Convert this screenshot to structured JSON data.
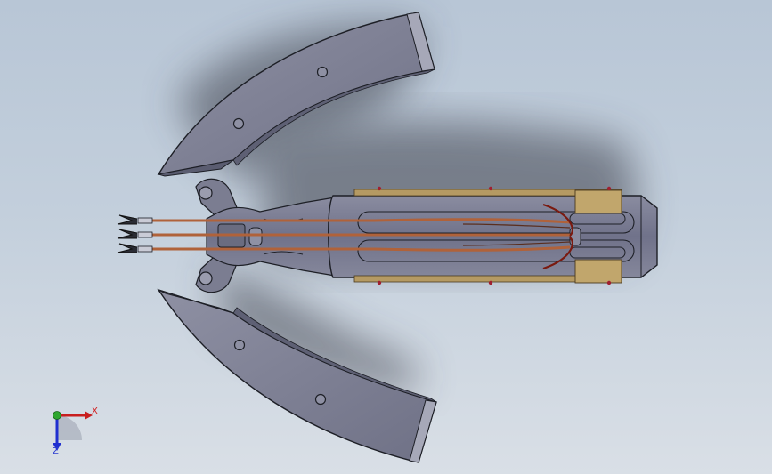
{
  "triad": {
    "x_label": "X",
    "z_label": "Z",
    "x_color": "#c81e1e",
    "y_color": "#2ea62e",
    "z_color": "#1f2fd0"
  },
  "colors": {
    "background_top": "#b8c6d6",
    "background_bottom": "#d9dfe6",
    "part_body": "#7d7f93",
    "part_edge": "#1d1f26",
    "rod_copper": "#b0623a",
    "plate_tan": "#b59a63"
  }
}
